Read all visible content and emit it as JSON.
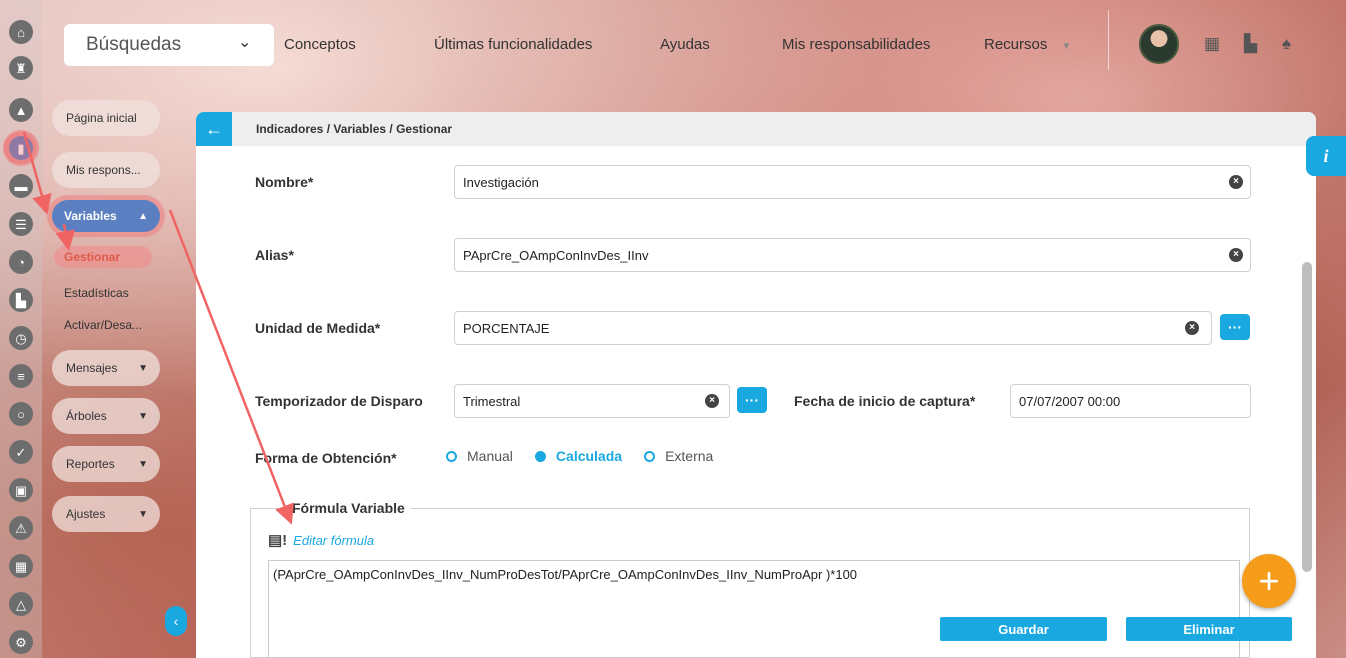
{
  "topbar": {
    "search_label": "Búsquedas",
    "nav": [
      "Conceptos",
      "Últimas funcionalidades",
      "Ayudas",
      "Mis responsabilidades",
      "Recursos"
    ]
  },
  "sidebar": {
    "items": [
      {
        "label": "Página inicial"
      },
      {
        "label": "Mis respons..."
      },
      {
        "label": "Variables"
      },
      {
        "label": "Gestionar"
      },
      {
        "label": "Estadísticas"
      },
      {
        "label": "Activar/Desa..."
      },
      {
        "label": "Mensajes"
      },
      {
        "label": "Árboles"
      },
      {
        "label": "Reportes"
      },
      {
        "label": "Ajustes"
      }
    ]
  },
  "panel": {
    "breadcrumb": "Indicadores / Variables / Gestionar",
    "info_label": "i"
  },
  "form": {
    "nombre_label": "Nombre*",
    "nombre_value": "Investigación",
    "alias_label": "Alias*",
    "alias_value": "PAprCre_OAmpConInvDes_IInv",
    "unidad_label": "Unidad de Medida*",
    "unidad_value": "PORCENTAJE",
    "temporizador_label": "Temporizador de Disparo",
    "temporizador_value": "Trimestral",
    "fecha_label": "Fecha de inicio de captura*",
    "fecha_value": "07/07/2007 00:00",
    "obtencion_label": "Forma de Obtención*",
    "obtencion_options": [
      "Manual",
      "Calculada",
      "Externa"
    ],
    "obtencion_selected": "Calculada",
    "formula_legend": "Fórmula Variable",
    "edit_formula_label": "Editar fórmula",
    "formula_value": "(PAprCre_OAmpConInvDes_IInv_NumProDesTot/PAprCre_OAmpConInvDes_IInv_NumProApr  )*100",
    "save_label": "Guardar",
    "delete_label": "Eliminar"
  },
  "colors": {
    "accent": "#1aa8e0",
    "fab": "#f59c1a",
    "annotation": "#f06464"
  }
}
